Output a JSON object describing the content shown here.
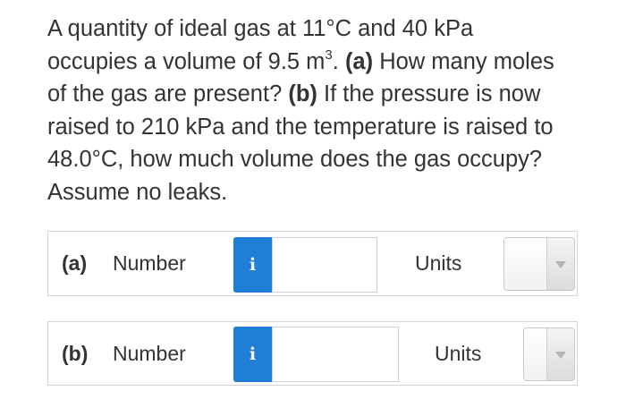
{
  "question": {
    "line1": "A quantity of ideal gas at 11°C and 40 kPa",
    "line2_pre": "occupies a volume of 9.5 m",
    "line2_sup": "3",
    "line2_mid": ". ",
    "line2_bold": "(a)",
    "line2_post": " How many moles",
    "line3_pre": "of the gas are present? ",
    "line3_bold": "(b)",
    "line3_post": " If the pressure is now",
    "line4": "raised to 210 kPa and the temperature is raised to",
    "line5": "48.0°C, how much volume does the gas occupy?",
    "line6": "Assume no leaks."
  },
  "part_a": {
    "label": "(a)",
    "number_label": "Number",
    "info_icon": "i",
    "number_value": "",
    "units_label": "Units",
    "units_value": ""
  },
  "part_b": {
    "label": "(b)",
    "number_label": "Number",
    "info_icon": "i",
    "number_value": "",
    "units_label": "Units",
    "units_value": ""
  },
  "colors": {
    "info_button": "#1f7fd6",
    "text": "#333333",
    "border": "#d5d5d5"
  }
}
